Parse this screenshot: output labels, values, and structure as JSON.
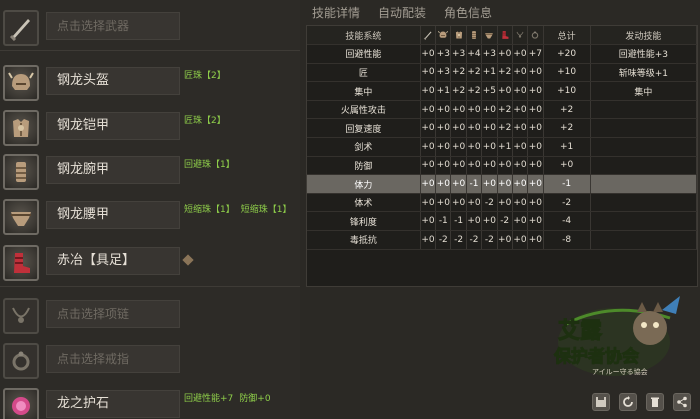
{
  "left_panel": {
    "slots": [
      {
        "name": "点击选择武器",
        "empty": true,
        "icon": "weapon-icon",
        "decorations": []
      },
      {
        "name": "钢龙头盔",
        "empty": false,
        "icon": "helmet-icon",
        "decorations": [
          "匠珠【2】"
        ]
      },
      {
        "name": "钢龙铠甲",
        "empty": false,
        "icon": "chest-armor-icon",
        "decorations": [
          "匠珠【2】"
        ]
      },
      {
        "name": "钢龙腕甲",
        "empty": false,
        "icon": "gauntlet-icon",
        "decorations": [
          "回避珠【1】"
        ]
      },
      {
        "name": "钢龙腰甲",
        "empty": false,
        "icon": "waist-armor-icon",
        "decorations": [
          "短缩珠【1】",
          "短缩珠【1】"
        ]
      },
      {
        "name": "赤冶【具足】",
        "empty": false,
        "icon": "greaves-icon",
        "decorations": []
      },
      {
        "name": "点击选择项链",
        "empty": true,
        "icon": "necklace-icon",
        "decorations": []
      },
      {
        "name": "点击选择戒指",
        "empty": true,
        "icon": "ring-icon",
        "decorations": []
      },
      {
        "name": "龙之护石",
        "empty": false,
        "icon": "talisman-icon",
        "decorations": [
          "回避性能+7",
          "防御+0"
        ]
      }
    ]
  },
  "tabs": [
    {
      "label": "技能详情",
      "active": true
    },
    {
      "label": "自动配装",
      "active": false
    },
    {
      "label": "角色信息",
      "active": false
    }
  ],
  "skill_table": {
    "header_label": "技能系统",
    "total_label": "总计",
    "active_label": "发动技能",
    "columns": [
      "weapon-icon",
      "helmet-icon",
      "chest-armor-icon",
      "gauntlet-icon",
      "waist-armor-icon",
      "greaves-icon",
      "necklace-icon",
      "ring-icon"
    ],
    "rows": [
      {
        "skill": "回避性能",
        "values": [
          "+0",
          "+3",
          "+3",
          "+4",
          "+3",
          "+0",
          "+0",
          "+7"
        ],
        "total": "+20",
        "active": "回避性能+3",
        "highlight": false
      },
      {
        "skill": "匠",
        "values": [
          "+0",
          "+3",
          "+2",
          "+2",
          "+1",
          "+2",
          "+0",
          "+0"
        ],
        "total": "+10",
        "active": "斩味等级+1",
        "highlight": false
      },
      {
        "skill": "集中",
        "values": [
          "+0",
          "+1",
          "+2",
          "+2",
          "+5",
          "+0",
          "+0",
          "+0"
        ],
        "total": "+10",
        "active": "集中",
        "highlight": false
      },
      {
        "skill": "火属性攻击",
        "values": [
          "+0",
          "+0",
          "+0",
          "+0",
          "+0",
          "+2",
          "+0",
          "+0"
        ],
        "total": "+2",
        "active": "",
        "highlight": false
      },
      {
        "skill": "回复速度",
        "values": [
          "+0",
          "+0",
          "+0",
          "+0",
          "+0",
          "+2",
          "+0",
          "+0"
        ],
        "total": "+2",
        "active": "",
        "highlight": false
      },
      {
        "skill": "剑术",
        "values": [
          "+0",
          "+0",
          "+0",
          "+0",
          "+0",
          "+1",
          "+0",
          "+0"
        ],
        "total": "+1",
        "active": "",
        "highlight": false
      },
      {
        "skill": "防御",
        "values": [
          "+0",
          "+0",
          "+0",
          "+0",
          "+0",
          "+0",
          "+0",
          "+0"
        ],
        "total": "+0",
        "active": "",
        "highlight": false
      },
      {
        "skill": "体力",
        "values": [
          "+0",
          "+0",
          "+0",
          "-1",
          "+0",
          "+0",
          "+0",
          "+0"
        ],
        "total": "-1",
        "active": "",
        "highlight": true
      },
      {
        "skill": "体术",
        "values": [
          "+0",
          "+0",
          "+0",
          "+0",
          "-2",
          "+0",
          "+0",
          "+0"
        ],
        "total": "-2",
        "active": "",
        "highlight": false
      },
      {
        "skill": "锋利度",
        "values": [
          "+0",
          "-1",
          "-1",
          "+0",
          "+0",
          "-2",
          "+0",
          "+0"
        ],
        "total": "-4",
        "active": "",
        "highlight": false
      },
      {
        "skill": "毒抵抗",
        "values": [
          "+0",
          "-2",
          "-2",
          "-2",
          "-2",
          "+0",
          "+0",
          "+0"
        ],
        "total": "-8",
        "active": "",
        "highlight": false
      }
    ]
  },
  "logo": {
    "line1": "艾露",
    "line2": "保护者协会",
    "subtitle": "アイルー守る協会"
  },
  "toolbar": [
    {
      "icon": "save-icon"
    },
    {
      "icon": "refresh-icon"
    },
    {
      "icon": "trash-icon"
    },
    {
      "icon": "share-icon"
    }
  ],
  "colors": {
    "accent_green": "#8fcf4a",
    "highlight_row": "#6a6761",
    "background": "#2b2925"
  }
}
